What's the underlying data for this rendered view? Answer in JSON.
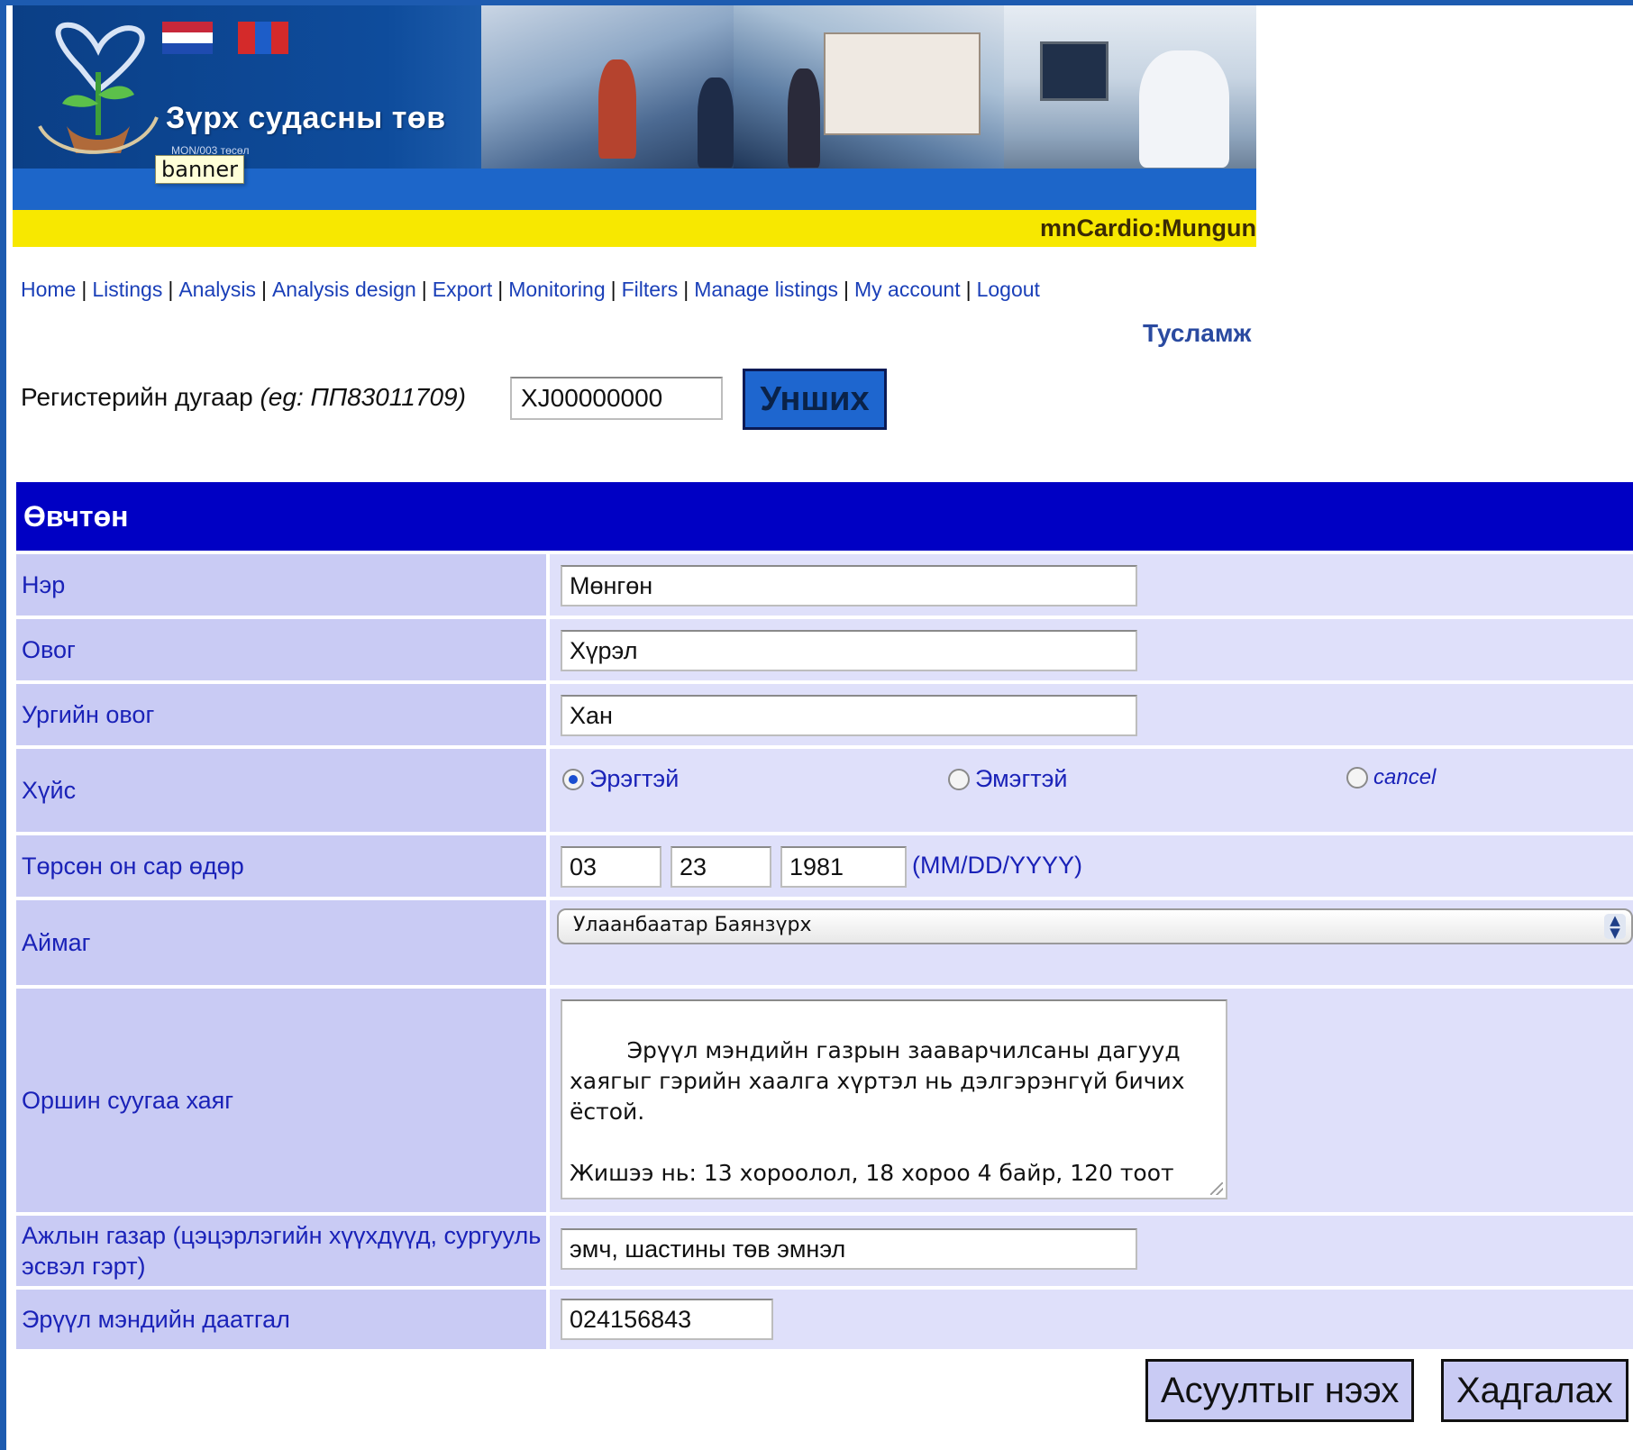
{
  "banner": {
    "site_title": "Зүрх судасны төв",
    "subtitle": "MON/003 төсөл",
    "tooltip": "banner",
    "user": "mnCardio:Mungun"
  },
  "nav": {
    "items": [
      "Home",
      "Listings",
      "Analysis",
      "Analysis design",
      "Export",
      "Monitoring",
      "Filters",
      "Manage listings",
      "My account",
      "Logout"
    ],
    "help": "Тусламж"
  },
  "search": {
    "label": "Регистерийн дугаар",
    "example": "(eg: ПП83011709)",
    "value": "XJ00000000",
    "button": "Унших"
  },
  "form": {
    "section_title": "Өвчтөн",
    "first_name": {
      "label": "Нэр",
      "value": "Мөнгөн"
    },
    "last_name": {
      "label": "Овог",
      "value": "Хүрэл"
    },
    "family_name": {
      "label": "Ургийн овог",
      "value": "Хан"
    },
    "gender": {
      "label": "Хүйс",
      "options": [
        "Эрэгтэй",
        "Эмэгтэй",
        "cancel"
      ],
      "selected": "Эрэгтэй"
    },
    "dob": {
      "label": "Төрсөн он сар өдөр",
      "month": "03",
      "day": "23",
      "year": "1981",
      "format": "(MM/DD/YYYY)"
    },
    "province": {
      "label": "Аймаг",
      "value": "Улаанбаатар Баянзүрх"
    },
    "address": {
      "label": "Оршин суугаа хаяг",
      "value": "Эрүүл мэндийн газрын зааварчилсаны дагууд\nхаягыг гэрийн хаалга хүртэл нь дэлгэрэнгүй бичих\nёстой.\n\nЖишээ нь: 13 хороолол, 18 хороо 4 байр, 120 тоот"
    },
    "workplace": {
      "label": "Ажлын газар (цэцэрлэгийн хүүхдүүд, сургууль эсвэл гэрт)",
      "value": "эмч, шастины төв эмнэл"
    },
    "insurance": {
      "label": "Эрүүл мэндийн даатгал",
      "value": "024156843"
    }
  },
  "actions": {
    "open_questions": "Асуултыг нээх",
    "save": "Хадгалах"
  },
  "colors": {
    "frame": "#1d5bb0",
    "header": "#0000c4",
    "label_bg": "#c9cbf4",
    "field_bg": "#dfe0fa",
    "link": "#1a3fb8",
    "banner_yellow": "#f7e800",
    "banner_blue": "#1d66c9"
  },
  "icons": [
    "heart-plant-logo",
    "netherlands-flag",
    "mongolia-flag",
    "select-arrows-icon",
    "resize-grip-icon"
  ]
}
